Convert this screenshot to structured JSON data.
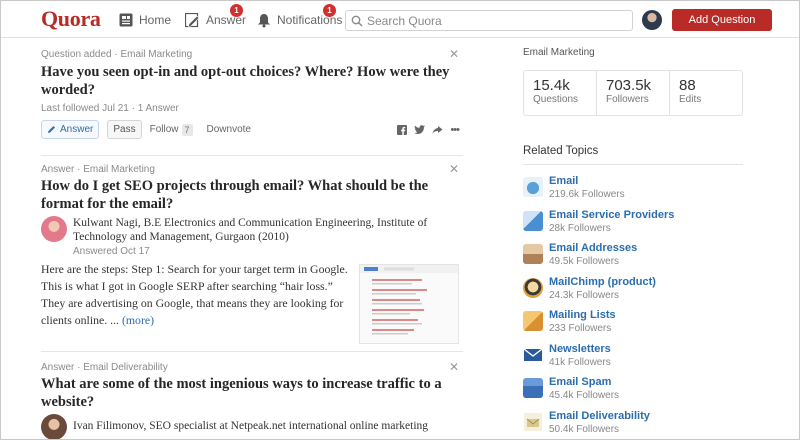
{
  "header": {
    "logo": "Quora",
    "nav": [
      {
        "label": "Home",
        "icon": "home-icon"
      },
      {
        "label": "Answer",
        "icon": "pencil-icon",
        "badge": "1"
      },
      {
        "label": "Notifications",
        "icon": "bell-icon",
        "badge": "1"
      }
    ],
    "search_placeholder": "Search Quora",
    "add_question": "Add Question"
  },
  "feed": [
    {
      "meta": "Question added · Email Marketing",
      "title": "Have you seen opt-in and opt-out choices? Where? How were they worded?",
      "sub_meta": "Last followed Jul 21 · 1 Answer",
      "actions": {
        "answer": "Answer",
        "pass": "Pass",
        "follow": "Follow",
        "follow_count": "7",
        "downvote": "Downvote"
      }
    },
    {
      "meta": "Answer · Email Marketing",
      "title": "How do I get SEO projects through email? What should be the format for the email?",
      "author": "Kulwant Nagi, B.E Electronics and Communication Engineering, Institute of Technology and Management, Gurgaon (2010)",
      "answered": "Answered Oct 17",
      "body": "Here are the steps: Step 1: Search for your target term in Google. This is what I got in Google SERP after searching “hair loss.” They are advertising on Google, that means they are looking for clients online. ...",
      "more": "(more)"
    },
    {
      "meta": "Answer · Email Deliverability",
      "title": "What are some of the most ingenious ways to increase traffic to a website?",
      "author": "Ivan Filimonov, SEO specialist at Netpeak.net international online marketing"
    }
  ],
  "sidebar": {
    "topic_title": "Email Marketing",
    "stats": [
      {
        "num": "15.4k",
        "label": "Questions"
      },
      {
        "num": "703.5k",
        "label": "Followers"
      },
      {
        "num": "88",
        "label": "Edits"
      }
    ],
    "related_title": "Related Topics",
    "topics": [
      {
        "name": "Email",
        "followers": "219.6k Followers",
        "color": "#5aa0d8"
      },
      {
        "name": "Email Service Providers",
        "followers": "28k Followers",
        "color": "#4a8fd0"
      },
      {
        "name": "Email Addresses",
        "followers": "49.5k Followers",
        "color": "#c9a070"
      },
      {
        "name": "MailChimp (product)",
        "followers": "24.3k Followers",
        "color": "#e0a040"
      },
      {
        "name": "Mailing Lists",
        "followers": "233 Followers",
        "color": "#e8b050"
      },
      {
        "name": "Newsletters",
        "followers": "41k Followers",
        "color": "#2a5a9a"
      },
      {
        "name": "Email Spam",
        "followers": "45.4k Followers",
        "color": "#3a70b8"
      },
      {
        "name": "Email Deliverability",
        "followers": "50.4k Followers",
        "color": "#d8d0a8"
      }
    ]
  }
}
